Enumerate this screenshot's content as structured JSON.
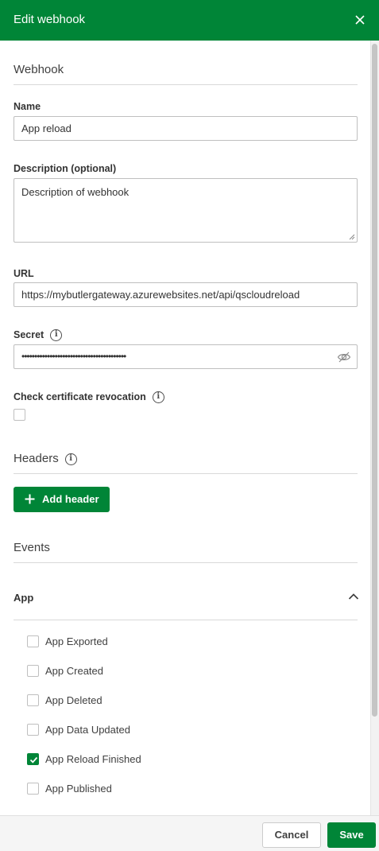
{
  "header": {
    "title": "Edit webhook"
  },
  "webhook_section": {
    "title": "Webhook"
  },
  "name": {
    "label": "Name",
    "value": "App reload"
  },
  "description": {
    "label": "Description (optional)",
    "value": "Description of webhook"
  },
  "url": {
    "label": "URL",
    "value": "https://mybutlergateway.azurewebsites.net/api/qscloudreload"
  },
  "secret": {
    "label": "Secret",
    "value": "•••••••••••••••••••••••••••••••••••••••••"
  },
  "cert_revocation": {
    "label": "Check certificate revocation",
    "checked": false
  },
  "headers_section": {
    "title": "Headers",
    "add_label": "Add header"
  },
  "events_section": {
    "title": "Events"
  },
  "app_group": {
    "title": "App",
    "items": [
      {
        "label": "App Exported",
        "checked": false
      },
      {
        "label": "App Created",
        "checked": false
      },
      {
        "label": "App Deleted",
        "checked": false
      },
      {
        "label": "App Data Updated",
        "checked": false
      },
      {
        "label": "App Reload Finished",
        "checked": true
      },
      {
        "label": "App Published",
        "checked": false
      }
    ]
  },
  "footer": {
    "cancel_label": "Cancel",
    "save_label": "Save"
  },
  "colors": {
    "brand_green": "#008537",
    "border": "#bfbfbf",
    "divider": "#d9d9d9"
  },
  "icons": [
    "close-icon",
    "info-icon",
    "eye-slash-icon",
    "plus-icon",
    "chevron-up-icon",
    "checkmark-icon"
  ]
}
